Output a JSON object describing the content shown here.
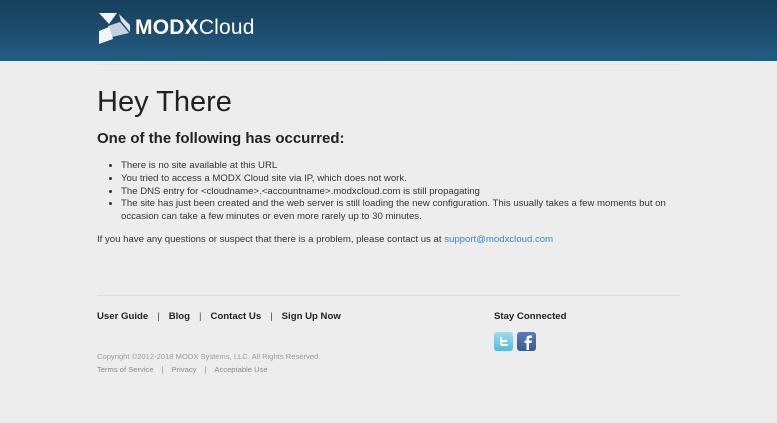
{
  "header": {
    "brand_bold": "MODX",
    "brand_light": "Cloud",
    "header_color": "#1d4e6f"
  },
  "main": {
    "title": "Hey There",
    "subtitle": "One of the following has occurred:",
    "reasons": [
      "There is no site available at this URL",
      "You tried to access a MODX Cloud site via IP, which does not work.",
      "The DNS entry for <cloudname>.<accountname>.modxcloud.com is still propagating",
      "The site has just been created and the web server is still loading the new configuration. This usually takes a few moments but on occasion can take a few minutes or even more rarely up to 30 minutes."
    ],
    "contact_text": "If you have any questions or suspect that there is a problem, please contact us at ",
    "contact_link": "support@modxcloud.com",
    "link_color": "#2a8bd2"
  },
  "footer": {
    "nav": [
      "User Guide",
      "Blog",
      "Contact Us",
      "Sign Up Now"
    ],
    "nav_separator": "|",
    "stay_connected": "Stay Connected",
    "social_icons": [
      "twitter-icon",
      "facebook-icon"
    ],
    "copyright": "Copyright ©2012-2018 MODX Systems, LLC. All Rights Reserved.",
    "legal": [
      "Terms of Service",
      "Privacy",
      "Acceptable Use"
    ],
    "legal_separator": "|"
  }
}
